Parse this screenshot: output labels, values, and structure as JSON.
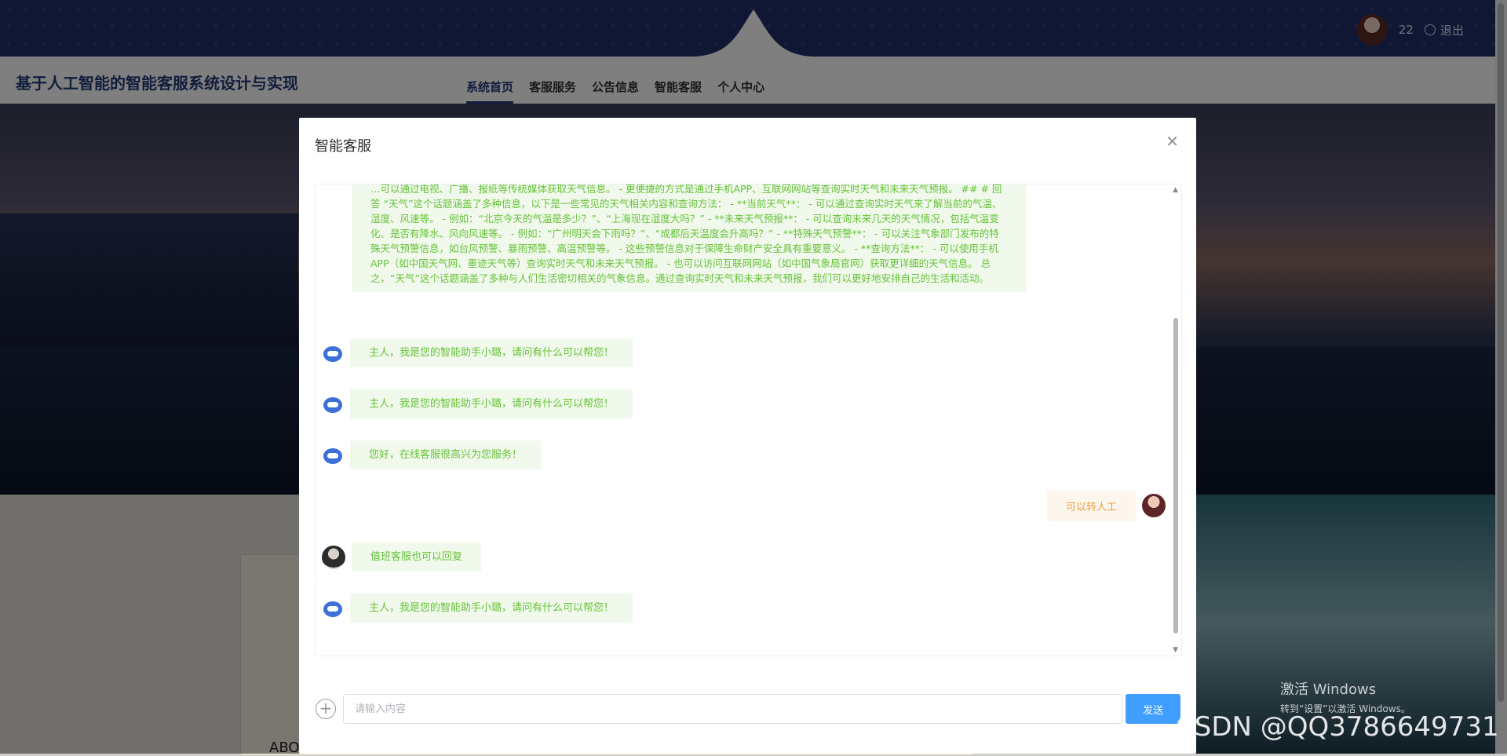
{
  "header": {
    "user_name": "22",
    "logout_label": "退出"
  },
  "site": {
    "title": "基于人工智能的智能客服系统设计与实现"
  },
  "nav": {
    "items": [
      {
        "label": "系统首页",
        "active": true
      },
      {
        "label": "客服服务",
        "active": false
      },
      {
        "label": "公告信息",
        "active": false
      },
      {
        "label": "智能客服",
        "active": false
      },
      {
        "label": "个人中心",
        "active": false
      }
    ]
  },
  "about": {
    "heading": "ABOUT US"
  },
  "dialog": {
    "title": "智能客服",
    "close_icon": "close-icon"
  },
  "chat": {
    "long_answer": "…可以通过电视、广播、报纸等传统媒体获取天气信息。 - 更便捷的方式是通过手机APP、互联网网站等查询实时天气和未来天气预报。 ## # 回答 “天气”这个话题涵盖了多种信息，以下是一些常见的天气相关内容和查询方法： - **当前天气**： - 可以通过查询实时天气来了解当前的气温、湿度、风速等。 - 例如：“北京今天的气温是多少？”、“上海现在湿度大吗？” - **未来天气预报**： - 可以查询未来几天的天气情况，包括气温变化、是否有降水、风向风速等。 - 例如：“广州明天会下雨吗？”、“成都后天温度会升高吗？” - **特殊天气预警**： - 可以关注气象部门发布的特殊天气预警信息，如台风预警、暴雨预警、高温预警等。 - 这些预警信息对于保障生命财产安全具有重要意义。 - **查询方法**： - 可以使用手机APP（如中国天气网、墨迹天气等）查询实时天气和未来天气预报。 - 也可以访问互联网网站（如中国气象局官网）获取更详细的天气信息。 总之，“天气”这个话题涵盖了多种与人们生活密切相关的气象信息。通过查询实时天气和未来天气预报，我们可以更好地安排自己的生活和活动。",
    "messages": [
      {
        "sender": "bot",
        "text": "主人，我是您的智能助手小璐，请问有什么可以帮您！"
      },
      {
        "sender": "bot",
        "text": "主人，我是您的智能助手小璐，请问有什么可以帮您！"
      },
      {
        "sender": "bot",
        "text": "您好，在线客服很高兴为您服务！"
      },
      {
        "sender": "user",
        "text": "可以转人工"
      },
      {
        "sender": "agent",
        "text": "值班客服也可以回复"
      },
      {
        "sender": "bot",
        "text": "主人，我是您的智能助手小璐，请问有什么可以帮您！"
      }
    ]
  },
  "composer": {
    "placeholder": "请输入内容",
    "send_label": "发送",
    "add_icon": "plus-circle-icon"
  },
  "os_overlay": {
    "activate_title": "激活 Windows",
    "activate_hint": "转到“设置”以激活 Windows。",
    "watermark": "CSDN @QQ3786649731"
  },
  "colors": {
    "header_bg": "#1f2f6a",
    "accent": "#409eff",
    "bot_bubble_bg": "#f0f9eb",
    "bot_text": "#67c23a",
    "user_bubble_bg": "#fdf6ec",
    "user_text": "#e6a23c"
  }
}
